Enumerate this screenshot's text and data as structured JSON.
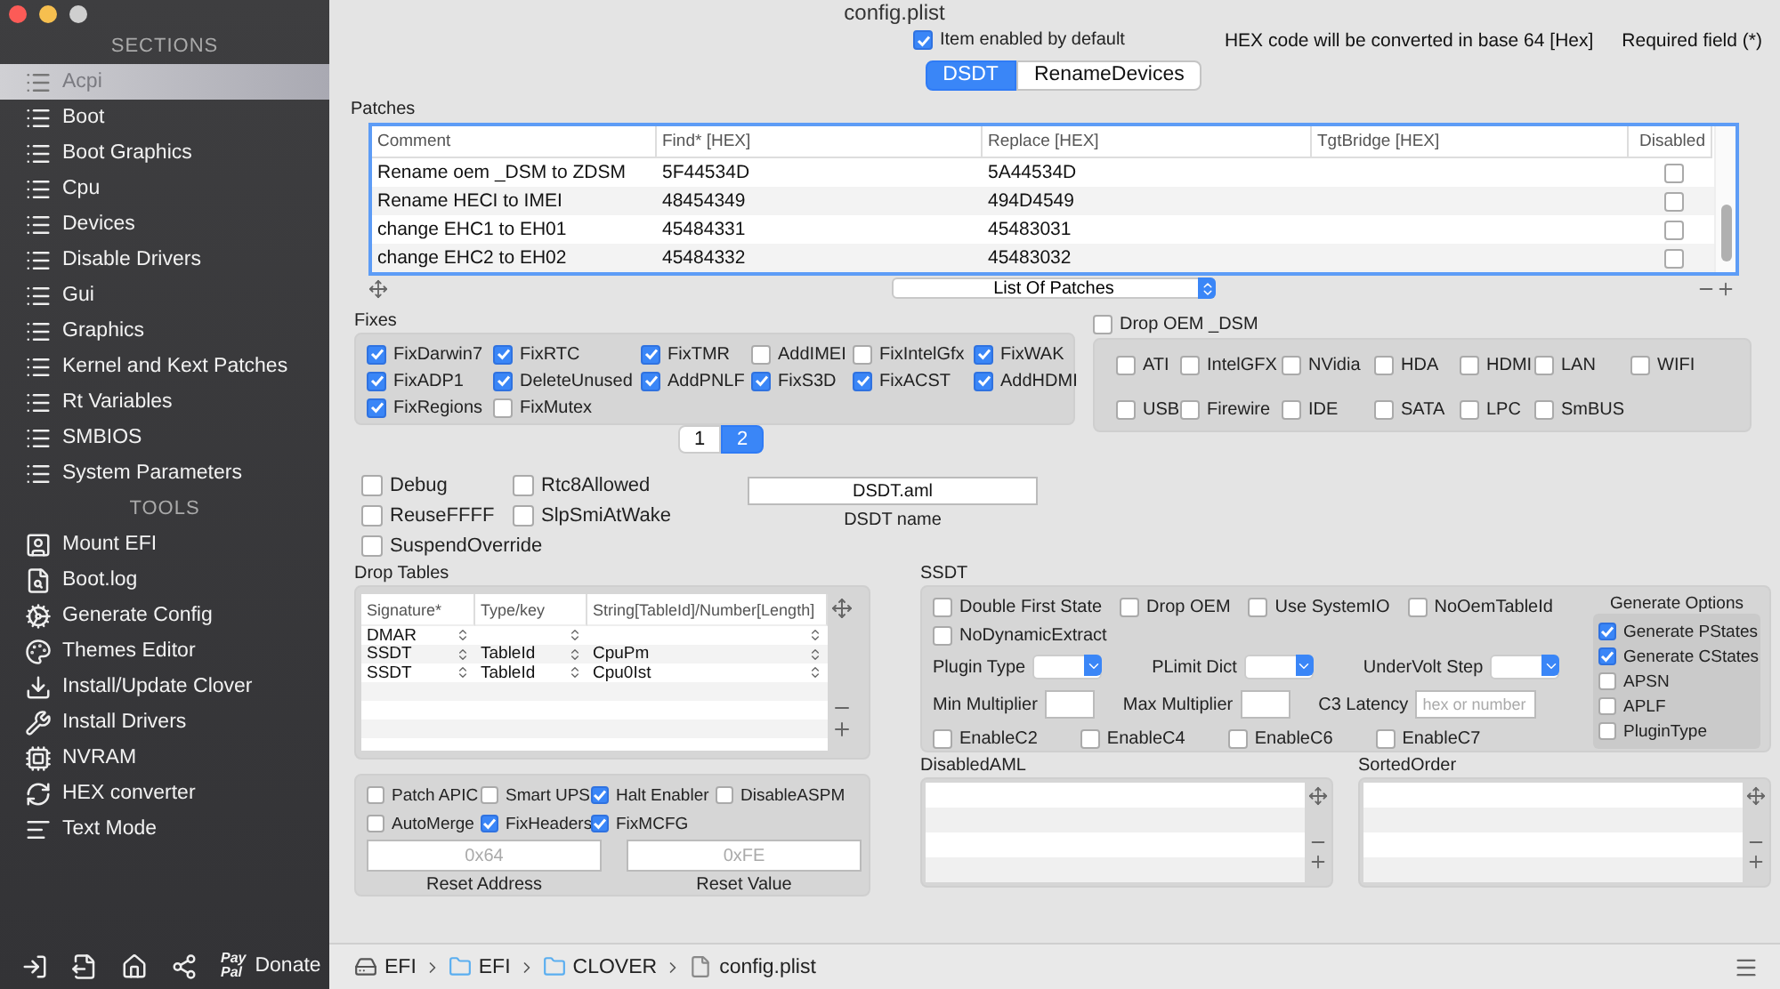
{
  "window": {
    "title": "config.plist"
  },
  "sidebar": {
    "sections_heading": "SECTIONS",
    "sections": [
      {
        "label": "Acpi",
        "selected": true
      },
      {
        "label": "Boot",
        "selected": false
      },
      {
        "label": "Boot Graphics",
        "selected": false
      },
      {
        "label": "Cpu",
        "selected": false
      },
      {
        "label": "Devices",
        "selected": false
      },
      {
        "label": "Disable Drivers",
        "selected": false
      },
      {
        "label": "Gui",
        "selected": false
      },
      {
        "label": "Graphics",
        "selected": false
      },
      {
        "label": "Kernel and Kext Patches",
        "selected": false
      },
      {
        "label": "Rt Variables",
        "selected": false
      },
      {
        "label": "SMBIOS",
        "selected": false
      },
      {
        "label": "System Parameters",
        "selected": false
      }
    ],
    "tools_heading": "TOOLS",
    "tools": [
      {
        "label": "Mount EFI",
        "kind": "mount"
      },
      {
        "label": "Boot.log",
        "kind": "log"
      },
      {
        "label": "Generate Config",
        "kind": "gears"
      },
      {
        "label": "Themes Editor",
        "kind": "palette"
      },
      {
        "label": "Install/Update Clover",
        "kind": "install"
      },
      {
        "label": "Install Drivers",
        "kind": "tools"
      },
      {
        "label": "NVRAM",
        "kind": "chip"
      },
      {
        "label": "HEX converter",
        "kind": "convert"
      },
      {
        "label": "Text Mode",
        "kind": "text"
      }
    ],
    "footer": {
      "paypal": [
        "Pay",
        "Pal"
      ],
      "donate": "Donate"
    }
  },
  "header": {
    "item_enabled": {
      "label": "Item enabled by default",
      "checked": true
    },
    "hex_note": "HEX code will be converted in base 64 [Hex]",
    "required_note": "Required field (*)"
  },
  "tabs": [
    {
      "label": "DSDT",
      "selected": true
    },
    {
      "label": "RenameDevices",
      "selected": false
    }
  ],
  "patches": {
    "title": "Patches",
    "columns": [
      "Comment",
      "Find* [HEX]",
      "Replace [HEX]",
      "TgtBridge [HEX]",
      "Disabled"
    ],
    "rows": [
      {
        "comment": "Rename oem _DSM to ZDSM",
        "find": "5F44534D",
        "replace": "5A44534D",
        "disabled": false
      },
      {
        "comment": "Rename HECI to IMEI",
        "find": "48454349",
        "replace": "494D4549",
        "disabled": false
      },
      {
        "comment": "change EHC1 to EH01",
        "find": "45484331",
        "replace": "45483031",
        "disabled": false
      },
      {
        "comment": "change EHC2 to EH02",
        "find": "45484332",
        "replace": "45483032",
        "disabled": false
      }
    ],
    "list_popup": "List Of Patches"
  },
  "fixes": {
    "title": "Fixes",
    "items": [
      {
        "label": "FixDarwin7",
        "checked": true
      },
      {
        "label": "FixRTC",
        "checked": true
      },
      {
        "label": "FixTMR",
        "checked": true
      },
      {
        "label": "AddIMEI",
        "checked": false
      },
      {
        "label": "FixIntelGfx",
        "checked": false
      },
      {
        "label": "FixWAK",
        "checked": true
      },
      {
        "label": "FixADP1",
        "checked": true
      },
      {
        "label": "DeleteUnused",
        "checked": true
      },
      {
        "label": "AddPNLF",
        "checked": true
      },
      {
        "label": "FixS3D",
        "checked": true
      },
      {
        "label": "FixACST",
        "checked": true
      },
      {
        "label": "AddHDMI",
        "checked": true
      },
      {
        "label": "FixRegions",
        "checked": true
      },
      {
        "label": "FixMutex",
        "checked": false
      }
    ]
  },
  "drop_oem": {
    "label": "Drop OEM _DSM",
    "checked": false,
    "items": [
      {
        "label": "ATI",
        "checked": false
      },
      {
        "label": "IntelGFX",
        "checked": false
      },
      {
        "label": "NVidia",
        "checked": false
      },
      {
        "label": "HDA",
        "checked": false
      },
      {
        "label": "HDMI",
        "checked": false
      },
      {
        "label": "LAN",
        "checked": false
      },
      {
        "label": "WIFI",
        "checked": false
      },
      {
        "label": "USB",
        "checked": false
      },
      {
        "label": "Firewire",
        "checked": false
      },
      {
        "label": "IDE",
        "checked": false
      },
      {
        "label": "SATA",
        "checked": false
      },
      {
        "label": "LPC",
        "checked": false
      },
      {
        "label": "SmBUS",
        "checked": false
      }
    ]
  },
  "pager": [
    {
      "label": "1",
      "selected": false
    },
    {
      "label": "2",
      "selected": true
    }
  ],
  "flags": [
    {
      "label": "Debug",
      "checked": false
    },
    {
      "label": "Rtc8Allowed",
      "checked": false
    },
    {
      "label": "ReuseFFFF",
      "checked": false
    },
    {
      "label": "SlpSmiAtWake",
      "checked": false
    },
    {
      "label": "SuspendOverride",
      "checked": false
    }
  ],
  "dsdt_name": {
    "value": "DSDT.aml",
    "label": "DSDT name"
  },
  "drop_tables": {
    "title": "Drop Tables",
    "columns": [
      "Signature*",
      "Type/key",
      "String[TableId]/Number[Length]"
    ],
    "rows": [
      {
        "signature": "DMAR"
      },
      {
        "signature": "SSDT",
        "type": "TableId",
        "string": "CpuPm"
      },
      {
        "signature": "SSDT",
        "type": "TableId",
        "string": "Cpu0Ist"
      }
    ]
  },
  "acpi_options": {
    "items": [
      {
        "label": "Patch APIC",
        "checked": false
      },
      {
        "label": "Smart UPS",
        "checked": false
      },
      {
        "label": "Halt Enabler",
        "checked": true
      },
      {
        "label": "DisableASPM",
        "checked": false
      },
      {
        "label": "AutoMerge",
        "checked": false
      },
      {
        "label": "FixHeaders",
        "checked": true
      },
      {
        "label": "FixMCFG",
        "checked": true
      }
    ],
    "reset_address": {
      "placeholder": "0x64",
      "label": "Reset Address"
    },
    "reset_value": {
      "placeholder": "0xFE",
      "label": "Reset Value"
    }
  },
  "ssdt": {
    "title": "SSDT",
    "checks": [
      {
        "label": "Double First State",
        "checked": false
      },
      {
        "label": "Drop OEM",
        "checked": false
      },
      {
        "label": "Use SystemIO",
        "checked": false
      },
      {
        "label": "NoOemTableId",
        "checked": false
      },
      {
        "label": "NoDynamicExtract",
        "checked": false
      }
    ],
    "selects": [
      {
        "label": "Plugin Type"
      },
      {
        "label": "PLimit Dict"
      },
      {
        "label": "UnderVolt Step"
      }
    ],
    "fields": [
      {
        "label": "Min Multiplier"
      },
      {
        "label": "Max Multiplier"
      },
      {
        "label": "C3 Latency",
        "placeholder": "hex or number"
      }
    ],
    "cstates": [
      {
        "label": "EnableC2",
        "checked": false
      },
      {
        "label": "EnableC4",
        "checked": false
      },
      {
        "label": "EnableC6",
        "checked": false
      },
      {
        "label": "EnableC7",
        "checked": false
      }
    ],
    "generate": {
      "title": "Generate Options",
      "items": [
        {
          "label": "Generate PStates",
          "checked": true
        },
        {
          "label": "Generate CStates",
          "checked": true
        },
        {
          "label": "APSN",
          "checked": false
        },
        {
          "label": "APLF",
          "checked": false
        },
        {
          "label": "PluginType",
          "checked": false
        }
      ]
    }
  },
  "disabled_aml": {
    "title": "DisabledAML"
  },
  "sorted_order": {
    "title": "SortedOrder"
  },
  "path": [
    {
      "label": "EFI",
      "kind": "drive"
    },
    {
      "label": "EFI",
      "kind": "folder"
    },
    {
      "label": "CLOVER",
      "kind": "folder"
    },
    {
      "label": "config.plist",
      "kind": "file"
    }
  ]
}
